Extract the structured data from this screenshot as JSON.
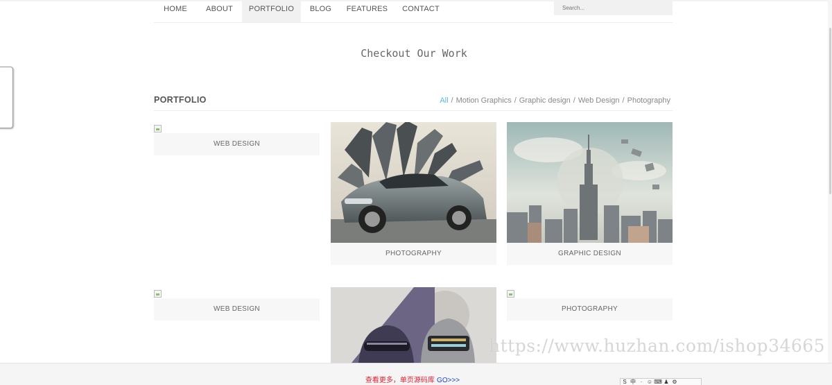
{
  "nav": {
    "items": [
      {
        "label": "HOME"
      },
      {
        "label": "ABOUT"
      },
      {
        "label": "PORTFOLIO",
        "active": true
      },
      {
        "label": "BLOG"
      },
      {
        "label": "FEATURES"
      },
      {
        "label": "CONTACT"
      }
    ],
    "search_placeholder": "Search..."
  },
  "hero": {
    "title": "Checkout Our Work"
  },
  "portfolio": {
    "title": "PORTFOLIO",
    "filters": [
      "All",
      "Motion Graphics",
      "Graphic design",
      "Web Design",
      "Photography"
    ],
    "active_filter": "All",
    "items": [
      {
        "caption": "WEB DESIGN",
        "image": "broken"
      },
      {
        "caption": "PHOTOGRAPHY",
        "image": "car-illustration"
      },
      {
        "caption": "GRAPHIC DESIGN",
        "image": "skyscraper-collage"
      },
      {
        "caption": "WEB DESIGN",
        "image": "broken"
      },
      {
        "caption": "",
        "image": "helmets-illustration"
      },
      {
        "caption": "PHOTOGRAPHY",
        "image": "broken"
      }
    ]
  },
  "footer": {
    "text": "查看更多，单页源码库",
    "link": "GO>>>"
  },
  "watermark": "https://www.huzhan.com/ishop34665",
  "ime_toolbar": [
    "S",
    "中",
    "·",
    "☺",
    "⌨",
    "♟",
    "⚙"
  ],
  "colors": {
    "accent": "#57b8d4",
    "footer_text": "#dd2233",
    "footer_link": "#1a3fd0"
  }
}
